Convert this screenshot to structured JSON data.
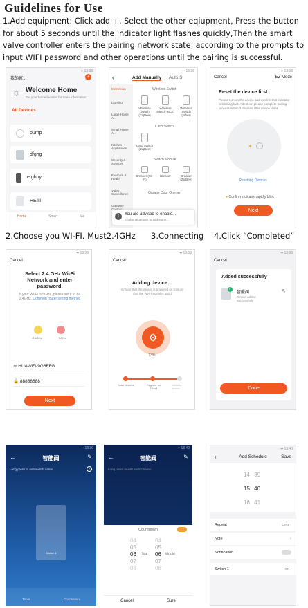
{
  "heading": "Guidelines for Use",
  "intro": "1.Add equipment: Click add +, Select the other eqiupment, Press the button for about 5 seconds until the indicator light flashes quickly,Then the smart valve controller enters the pairing network state, according to the prompts to input WIFI password and other operations until the pairing is successful.",
  "captions": {
    "c2": "2.Choose you WI-FI.  Must2.4GHz",
    "c3": "3.Connecting",
    "c4": "4.Click “Completed”"
  },
  "p1": {
    "home_label": "我的家 ..",
    "welcome": "Welcome Home",
    "welcome_sub": "Set your home location for more information",
    "all_devices": "All Devices",
    "devices": [
      "pump",
      "dfghg",
      "etghhy",
      "HEllll"
    ],
    "tabs": [
      "Home",
      "Smart",
      "Me"
    ]
  },
  "p2": {
    "tab_add": "Add Manually",
    "tab_auto": "Auto S",
    "categories": [
      "Electrician",
      "Lighting",
      "Large Home A...",
      "Small Home A...",
      "Kitchen Appliances",
      "Security & Sensors",
      "Exercise & Health",
      "Video Surveillance",
      "Gateway Control"
    ],
    "sec_wireless": "Wireless Switch",
    "sec_card": "Card Switch",
    "sec_module": "Switch Module",
    "sec_garage": "Garage Door Opener",
    "wireless_items": [
      "Wireless Switch (ZigBee)",
      "Wireless Switch (BLE)",
      "Wireless Switch (other)"
    ],
    "card_item": "Card Switch (ZigBee)",
    "module_items": [
      "Breaker (Wi-Fi)",
      "Breaker",
      "Breaker (ZigBee)"
    ],
    "banner": "You are advised to enable...",
    "banner_sub": "Enable Bluetooth to add some..."
  },
  "p3": {
    "cancel": "Cancel",
    "mode": "EZ Mode",
    "title": "Reset the device first.",
    "desc": "Please turn on the device and confirm that indicator is blinking fast. Attention: please complete pairing process within 3 minutes after device reset.",
    "link": "Resetting Devices",
    "confirm": "Confirm indicator rapidly blink",
    "next": "Next"
  },
  "p4": {
    "cancel": "Cancel",
    "title": "Select 2.4 GHz Wi-Fi Network and enter password.",
    "desc": "If your Wi-Fi is 5GHz, please set it to be 2.4GHz.",
    "desc_link": "Common router setting method",
    "band1": "2.4GHz",
    "band2": "5GHz",
    "ssid": "HUAWEI-9G6FFG",
    "password": "88888888",
    "next": "Next"
  },
  "p5": {
    "cancel": "Cancel",
    "title": "Adding device...",
    "sub": "Ensure that the device is powered on Ensure that the Wi-Fi signal is good",
    "percent": "13%",
    "steps": [
      "Scan devices",
      "Register on Cloud",
      "Initialize device"
    ]
  },
  "p6": {
    "cancel": "Cancel",
    "title": "Added successfully",
    "device_name": "智能阀",
    "device_status": "Device added successfully",
    "done": "Done"
  },
  "p7": {
    "title": "智能阀",
    "hint": "Long press to edit switch name",
    "switch_label": "Switch 1",
    "bottom": [
      "Timer",
      "Countdown"
    ]
  },
  "p8": {
    "title": "智能阀",
    "hint": "Long press to edit switch name",
    "countdown": "Countdown",
    "hours": [
      "04",
      "05",
      "06",
      "07",
      "08"
    ],
    "minutes": [
      "04",
      "05",
      "06",
      "07",
      "08"
    ],
    "hour_label": "Hour",
    "minute_label": "Minute",
    "cancel": "Cancel",
    "sure": "Sure"
  },
  "p9": {
    "title": "Add Schedule",
    "save": "Save",
    "times": [
      [
        "14",
        "39"
      ],
      [
        "15",
        "40"
      ],
      [
        "16",
        "41"
      ]
    ],
    "rows": [
      {
        "label": "Repeat",
        "value": "Once"
      },
      {
        "label": "Note",
        "value": ""
      },
      {
        "label": "Notification",
        "value": ""
      },
      {
        "label": "Switch 1",
        "value": "ON"
      }
    ]
  },
  "colors": {
    "accent": "#f05a22",
    "blue_dark": "#0d2a5c"
  }
}
